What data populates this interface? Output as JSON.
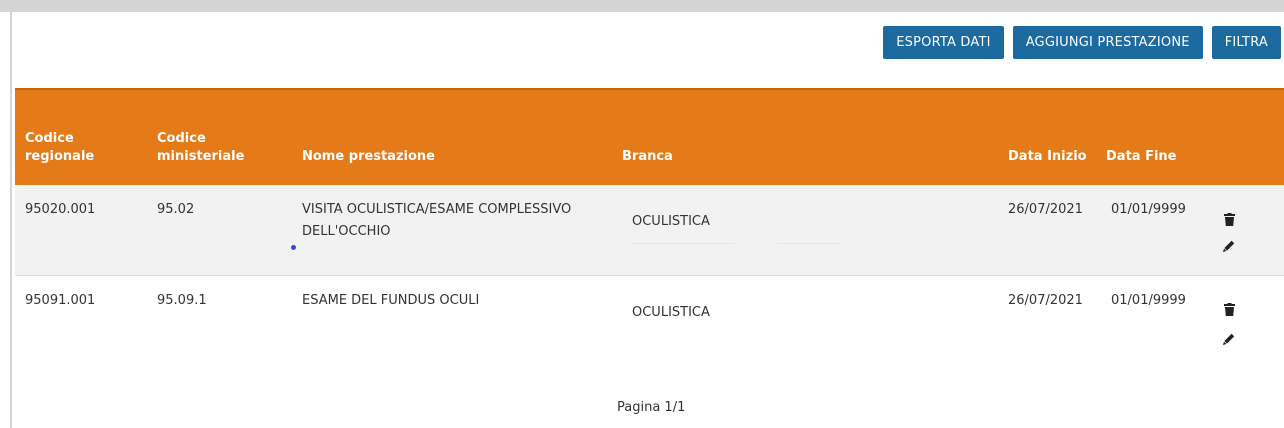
{
  "toolbar": {
    "export_label": "ESPORTA DATI",
    "add_label": "AGGIUNGI PRESTAZIONE",
    "filter_label": "FILTRA"
  },
  "table": {
    "headers": {
      "codice_regionale": "Codice\nregionale",
      "codice_ministeriale": "Codice\nministeriale",
      "nome": "Nome prestazione",
      "branca": "Branca",
      "data_inizio": "Data Inizio",
      "data_fine": "Data Fine"
    },
    "rows": [
      {
        "codice_regionale": "95020.001",
        "codice_ministeriale": "95.02",
        "nome": "VISITA OCULISTICA/ESAME COMPLESSIVO DELL'OCCHIO",
        "branca": "OCULISTICA",
        "data_inizio": "26/07/2021",
        "data_fine": "01/01/9999"
      },
      {
        "codice_regionale": "95091.001",
        "codice_ministeriale": "95.09.1",
        "nome": "ESAME DEL FUNDUS OCULI",
        "branca": "OCULISTICA",
        "data_inizio": "26/07/2021",
        "data_fine": "01/01/9999"
      }
    ]
  },
  "pagination": {
    "label": "Pagina 1/1"
  },
  "colors": {
    "header": "#e57b18",
    "button": "#1b6aa0",
    "row_alt": "#f2f2f2"
  },
  "icons": {
    "delete": "trash-icon",
    "edit": "pencil-icon"
  }
}
